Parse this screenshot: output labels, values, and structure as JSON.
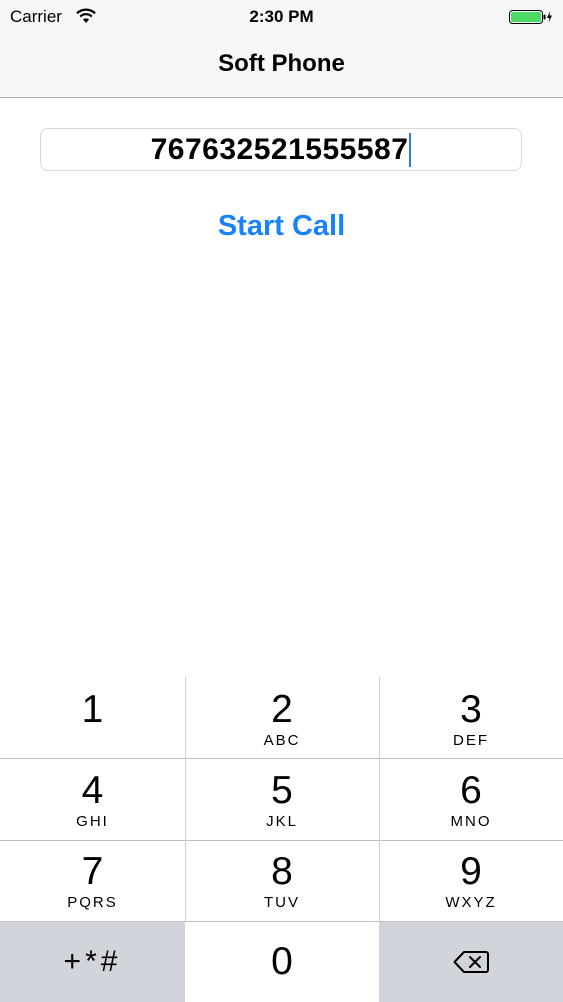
{
  "status_bar": {
    "carrier": "Carrier",
    "time": "2:30 PM",
    "wifi_icon": "wifi-icon",
    "battery_icon": "battery-charging-icon",
    "battery_color": "#4cd964"
  },
  "nav": {
    "title": "Soft Phone"
  },
  "phone_field": {
    "value": "767632521555587"
  },
  "start_call": {
    "label": "Start Call",
    "color": "#1a82fb"
  },
  "keypad": {
    "keys": [
      {
        "digit": "1",
        "letters": ""
      },
      {
        "digit": "2",
        "letters": "ABC"
      },
      {
        "digit": "3",
        "letters": "DEF"
      },
      {
        "digit": "4",
        "letters": "GHI"
      },
      {
        "digit": "5",
        "letters": "JKL"
      },
      {
        "digit": "6",
        "letters": "MNO"
      },
      {
        "digit": "7",
        "letters": "PQRS"
      },
      {
        "digit": "8",
        "letters": "TUV"
      },
      {
        "digit": "9",
        "letters": "WXYZ"
      }
    ],
    "symbols": "+*#",
    "zero": "0",
    "delete_icon": "backspace-icon"
  }
}
